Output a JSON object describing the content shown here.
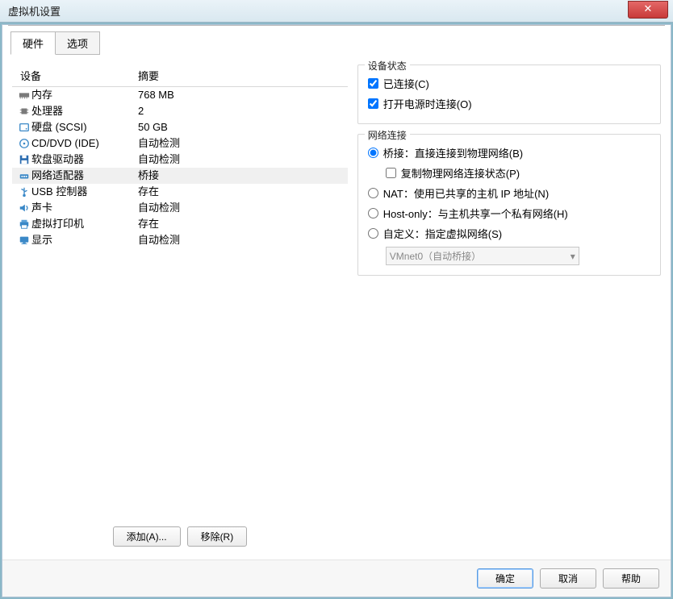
{
  "window": {
    "title": "虚拟机设置"
  },
  "tabs": {
    "hardware": "硬件",
    "options": "选项"
  },
  "columns": {
    "device": "设备",
    "summary": "摘要"
  },
  "hardware": [
    {
      "icon": "memory-icon",
      "name": "内存",
      "summary": "768 MB",
      "selected": false
    },
    {
      "icon": "cpu-icon",
      "name": "处理器",
      "summary": "2",
      "selected": false
    },
    {
      "icon": "disk-icon",
      "name": "硬盘 (SCSI)",
      "summary": "50 GB",
      "selected": false
    },
    {
      "icon": "cd-icon",
      "name": "CD/DVD (IDE)",
      "summary": "自动检测",
      "selected": false
    },
    {
      "icon": "floppy-icon",
      "name": "软盘驱动器",
      "summary": "自动检测",
      "selected": false
    },
    {
      "icon": "network-icon",
      "name": "网络适配器",
      "summary": "桥接",
      "selected": true
    },
    {
      "icon": "usb-icon",
      "name": "USB 控制器",
      "summary": "存在",
      "selected": false
    },
    {
      "icon": "sound-icon",
      "name": "声卡",
      "summary": "自动检测",
      "selected": false
    },
    {
      "icon": "printer-icon",
      "name": "虚拟打印机",
      "summary": "存在",
      "selected": false
    },
    {
      "icon": "display-icon",
      "name": "显示",
      "summary": "自动检测",
      "selected": false
    }
  ],
  "buttons": {
    "add": "添加(A)...",
    "remove": "移除(R)",
    "ok": "确定",
    "cancel": "取消",
    "help": "帮助"
  },
  "status_group": {
    "title": "设备状态",
    "connected": "已连接(C)",
    "connect_on_power": "打开电源时连接(O)"
  },
  "network_group": {
    "title": "网络连接",
    "bridged": "桥接：直接连接到物理网络(B)",
    "replicate": "复制物理网络连接状态(P)",
    "nat": "NAT：使用已共享的主机 IP 地址(N)",
    "hostonly": "Host-only：与主机共享一个私有网络(H)",
    "custom": "自定义：指定虚拟网络(S)",
    "custom_value": "VMnet0（自动桥接）"
  }
}
